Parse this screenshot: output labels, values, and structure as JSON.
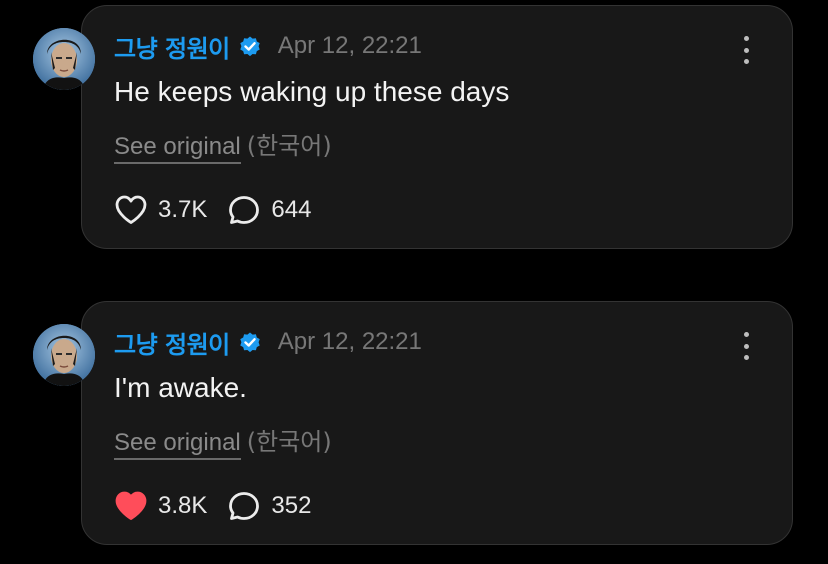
{
  "posts": [
    {
      "author": "그냥 정원이",
      "timestamp": "Apr 12, 22:21",
      "text": "He keeps waking up these days",
      "see_original": "See original",
      "language": "(한국어)",
      "likes": "3.7K",
      "liked": false,
      "replies": "644"
    },
    {
      "author": "그냥 정원이",
      "timestamp": "Apr 12, 22:21",
      "text": "I'm awake.",
      "see_original": "See original",
      "language": "(한국어)",
      "likes": "3.8K",
      "liked": true,
      "replies": "352"
    }
  ],
  "icons": {
    "verified": "verified-badge-icon",
    "like": "heart-icon",
    "reply": "reply-bubble-icon",
    "more": "more-vertical-icon"
  },
  "colors": {
    "background": "#000000",
    "card": "#181818",
    "card_border": "#333333",
    "author": "#1d9bf0",
    "verified": "#1d9bf0",
    "liked_heart": "#ff4d5a",
    "muted": "#777777",
    "text": "#f3f3f3"
  }
}
